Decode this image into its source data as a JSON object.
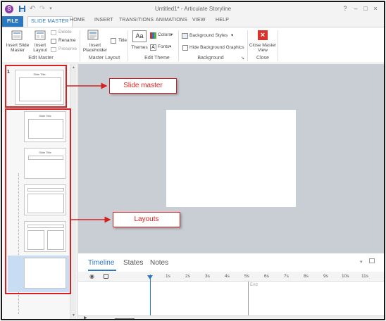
{
  "window": {
    "title": "Untitled1* - Articulate Storyline",
    "app_logo": "S",
    "controls": [
      "?",
      "–",
      "□",
      "×"
    ]
  },
  "tabs": [
    "FILE",
    "SLIDE MASTER",
    "HOME",
    "INSERT",
    "TRANSITIONS",
    "ANIMATIONS",
    "VIEW",
    "HELP"
  ],
  "ribbon": {
    "edit_master": {
      "label": "Edit Master",
      "insert_slide_master": "Insert Slide Master",
      "insert_layout": "Insert Layout",
      "delete": "Delete",
      "rename": "Rename",
      "preserve": "Preserve"
    },
    "master_layout": {
      "label": "Master Layout",
      "insert_placeholder": "Insert Placeholder",
      "title": "Title"
    },
    "edit_theme": {
      "label": "Edit Theme",
      "themes": "Themes",
      "colors": "Colors",
      "fonts": "Fonts"
    },
    "background": {
      "label": "Background",
      "background_styles": "Background Styles",
      "hide_background_graphics": "Hide Background Graphics"
    },
    "close": {
      "label": "Close",
      "close_master_view": "Close Master View"
    }
  },
  "slides_panel": {
    "master_number": "1",
    "master_thumb_title": "Slide Title",
    "layout_titles": [
      "Slide Title",
      "Slide Title",
      "",
      "",
      ""
    ]
  },
  "callouts": {
    "slide_master": "Slide master",
    "layouts": "Layouts"
  },
  "timeline": {
    "tabs": [
      "Timeline",
      "States",
      "Notes"
    ],
    "active_tab": "Timeline",
    "ticks": [
      "1s",
      "2s",
      "3s",
      "4s",
      "5s",
      "6s",
      "7s",
      "8s",
      "9s",
      "10s",
      "11s"
    ],
    "end_label": "End"
  },
  "colors": {
    "accent": "#2b78c2",
    "annotation_red": "#d42020",
    "canvas_bg": "#c9ced5"
  }
}
